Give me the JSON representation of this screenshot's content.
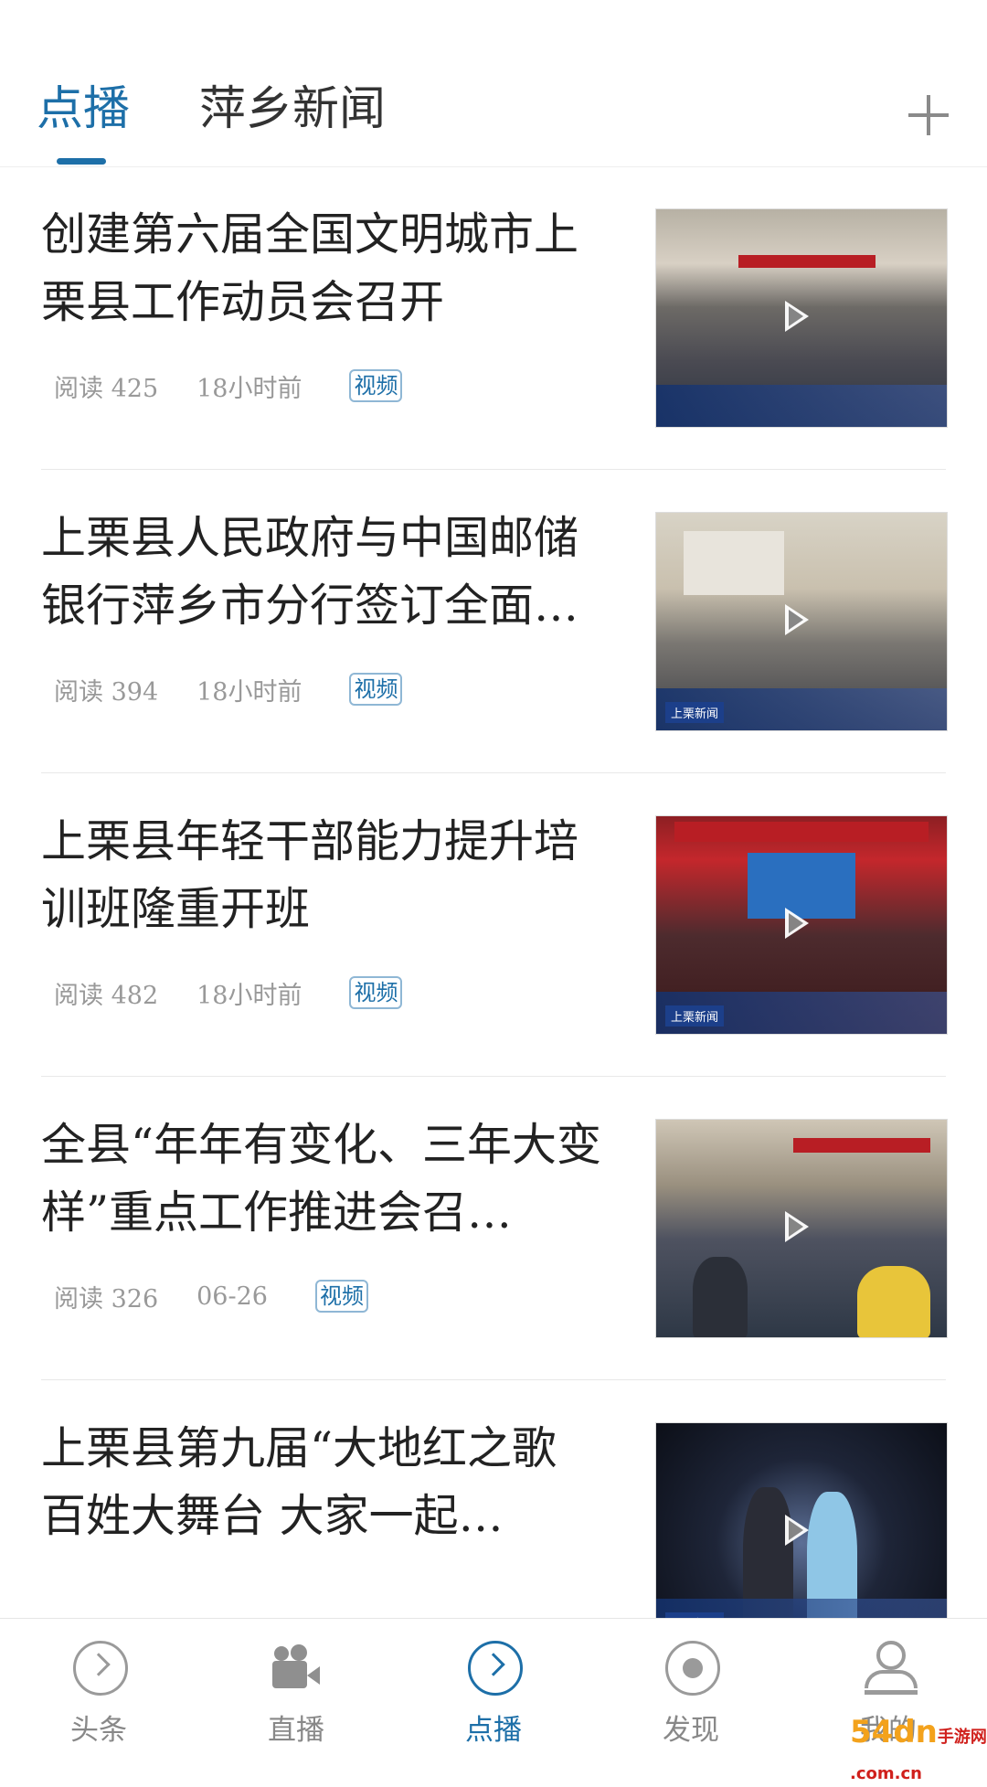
{
  "top_tabs": [
    {
      "label": "点播",
      "active": true
    },
    {
      "label": "萍乡新闻",
      "active": false
    }
  ],
  "add_tab_icon": "plus-icon",
  "news": [
    {
      "title": "创建第六届全国文明城市上栗县工作动员会召开",
      "reads": "阅读 425",
      "time": "18小时前",
      "badge": "视频"
    },
    {
      "title": "上栗县人民政府与中国邮储银行萍乡市分行签订全面…",
      "reads": "阅读 394",
      "time": "18小时前",
      "badge": "视频"
    },
    {
      "title": "上栗县年轻干部能力提升培训班隆重开班",
      "reads": "阅读 482",
      "time": "18小时前",
      "badge": "视频"
    },
    {
      "title": "全县“年年有变化、三年大变样”重点工作推进会召…",
      "reads": "阅读 326",
      "time": "06-26",
      "badge": "视频"
    },
    {
      "title": "上栗县第九届“大地红之歌 百姓大舞台 大家一起…",
      "reads": "",
      "time": "",
      "badge": ""
    }
  ],
  "thumb_caption": "上栗新闻",
  "bottom_nav": [
    {
      "label": "头条",
      "icon": "circle-chevron-icon",
      "active": false
    },
    {
      "label": "直播",
      "icon": "video-camera-icon",
      "active": false
    },
    {
      "label": "点播",
      "icon": "circle-chevron-icon",
      "active": true
    },
    {
      "label": "发现",
      "icon": "disc-icon",
      "active": false
    },
    {
      "label": "我的",
      "icon": "user-icon",
      "active": false
    }
  ],
  "watermark": {
    "main": "54dn",
    "sub": "手游网 .com.cn"
  },
  "colors": {
    "accent": "#1d6fa8",
    "inactive": "#888888",
    "meta": "#999999"
  }
}
